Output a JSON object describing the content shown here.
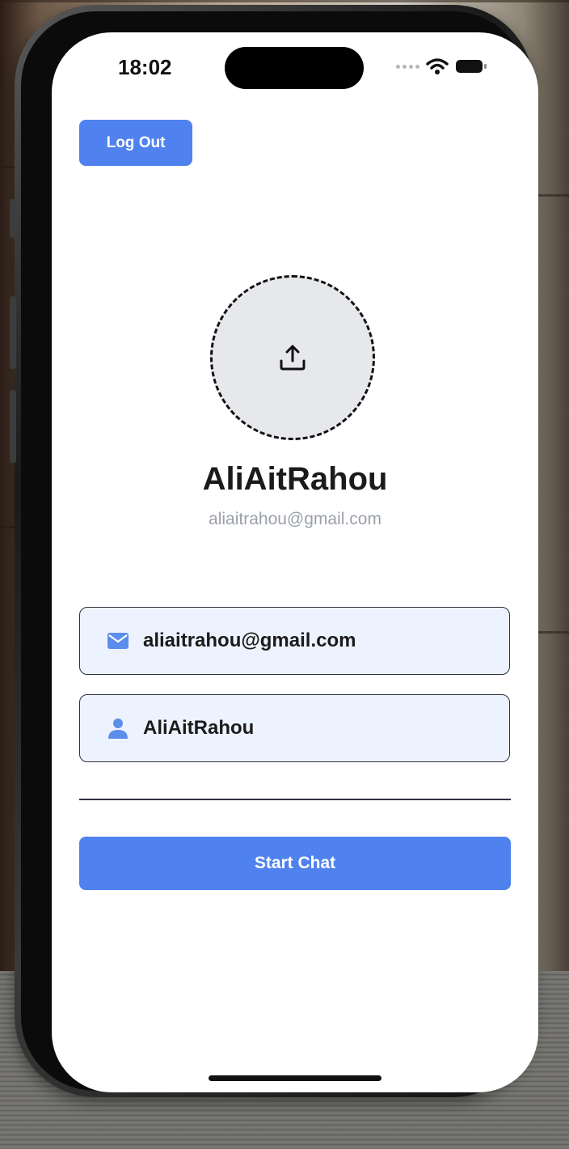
{
  "status_bar": {
    "time": "18:02",
    "icons": [
      "signal-dots-icon",
      "wifi-icon",
      "battery-icon"
    ]
  },
  "header": {
    "logout_label": "Log Out"
  },
  "profile": {
    "avatar_icon": "upload-icon",
    "name": "AliAitRahou",
    "email": "aliaitrahou@gmail.com"
  },
  "form": {
    "email_field": {
      "icon": "mail-icon",
      "value": "aliaitrahou@gmail.com"
    },
    "name_field": {
      "icon": "person-icon",
      "value": "AliAitRahou"
    }
  },
  "actions": {
    "start_chat_label": "Start Chat"
  },
  "colors": {
    "accent": "#4f82ee",
    "field_background": "#edf3fe",
    "muted_text": "#9aa0a8"
  }
}
